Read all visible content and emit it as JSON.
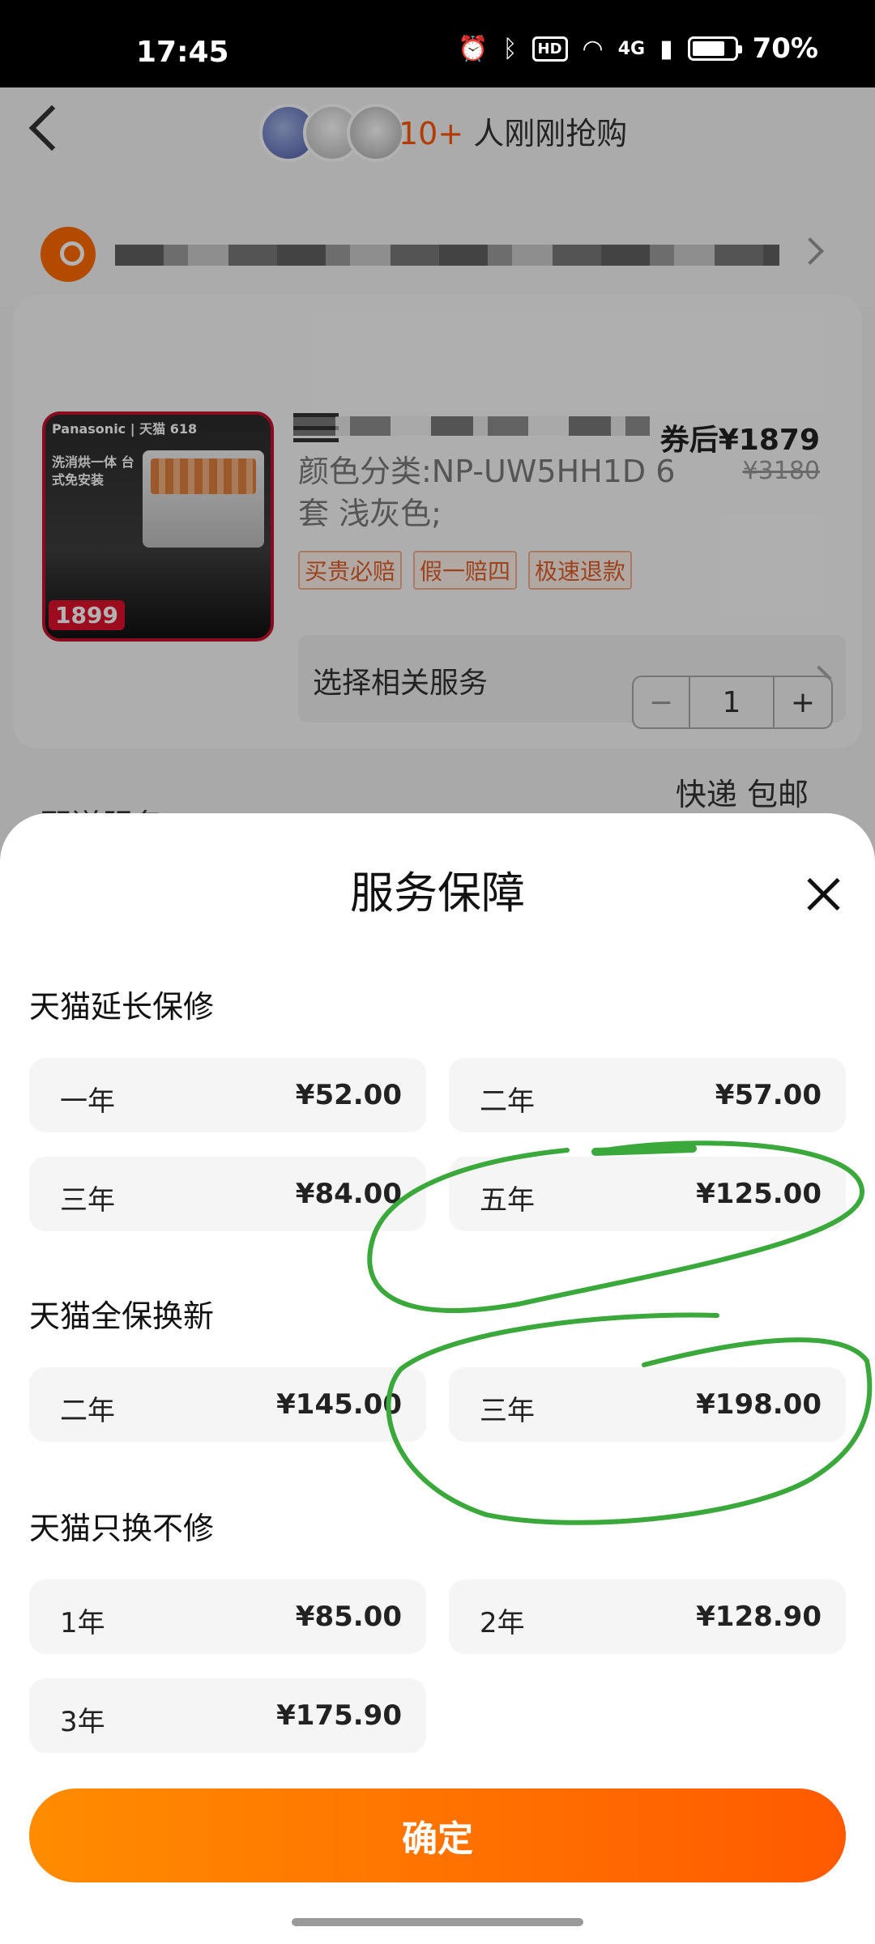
{
  "status_bar": {
    "time": "17:45",
    "icons": [
      "alarm-icon",
      "bluetooth-icon",
      "hd-icon",
      "wifi-icon",
      "4g-signal-icon",
      "battery-icon"
    ],
    "hd_label": "HD",
    "network": "4G",
    "battery": "70%"
  },
  "header": {
    "buy_count": "10+",
    "buy_text": "人刚刚抢购"
  },
  "product": {
    "brand_text": "Panasonic | 天猫 618",
    "image_promo": "洗消烘一体 台式免安装",
    "image_price": "1899",
    "sku": "颜色分类:NP-UW5HH1D 6套 浅灰色;",
    "after_coupon_price": "券后¥1879",
    "original_price": "¥3180",
    "tags": [
      "买贵必赔",
      "假一赔四",
      "极速退款"
    ],
    "service_select_label": "选择相关服务",
    "quantity": "1",
    "minus": "−",
    "plus": "+"
  },
  "shipping": {
    "label": "配送服务",
    "method": "快递 包邮"
  },
  "sheet": {
    "title": "服务保障",
    "sections": [
      {
        "title": "天猫延长保修",
        "options": [
          {
            "name": "一年",
            "price": "¥52.00"
          },
          {
            "name": "二年",
            "price": "¥57.00"
          },
          {
            "name": "三年",
            "price": "¥84.00"
          },
          {
            "name": "五年",
            "price": "¥125.00"
          }
        ]
      },
      {
        "title": "天猫全保换新",
        "options": [
          {
            "name": "二年",
            "price": "¥145.00"
          },
          {
            "name": "三年",
            "price": "¥198.00"
          }
        ]
      },
      {
        "title": "天猫只换不修",
        "options": [
          {
            "name": "1年",
            "price": "¥85.00"
          },
          {
            "name": "2年",
            "price": "¥128.90"
          },
          {
            "name": "3年",
            "price": "¥175.90"
          }
        ]
      }
    ],
    "confirm_label": "确定"
  },
  "annotation_color": "#3aa83a"
}
